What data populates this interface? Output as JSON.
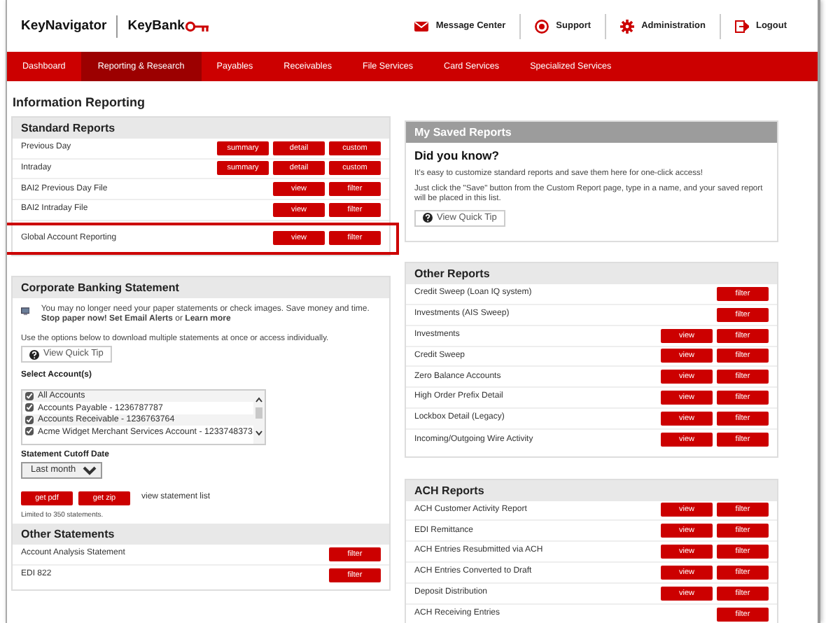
{
  "header": {
    "product": "KeyNavigator",
    "bank": "KeyBank",
    "links": [
      {
        "label": "Message Center"
      },
      {
        "label": "Support"
      },
      {
        "label": "Administration"
      },
      {
        "label": "Logout"
      }
    ]
  },
  "nav": [
    {
      "label": "Dashboard",
      "selected": false
    },
    {
      "label": "Reporting & Research",
      "selected": true
    },
    {
      "label": "Payables",
      "selected": false
    },
    {
      "label": "Receivables",
      "selected": false
    },
    {
      "label": "File Services",
      "selected": false
    },
    {
      "label": "Card Services",
      "selected": false
    },
    {
      "label": "Specialized Services",
      "selected": false
    }
  ],
  "page_title": "Information Reporting",
  "standard_reports": {
    "title": "Standard Reports",
    "rows": [
      {
        "label": "Previous Day",
        "buttons": [
          "summary",
          "detail",
          "custom"
        ],
        "highlighted": false
      },
      {
        "label": "Intraday",
        "buttons": [
          "summary",
          "detail",
          "custom"
        ],
        "highlighted": false
      },
      {
        "label": "BAI2 Previous Day File",
        "buttons": [
          "view",
          "filter"
        ],
        "highlighted": false
      },
      {
        "label": "BAI2 Intraday File",
        "buttons": [
          "view",
          "filter"
        ],
        "highlighted": false
      },
      {
        "label": "Global Account Reporting",
        "buttons": [
          "view",
          "filter"
        ],
        "highlighted": true
      }
    ]
  },
  "corporate_statement": {
    "title": "Corporate Banking Statement",
    "notice": "You may no longer need your paper statements or check images. Save money and time. **Stop paper now!**   **Set Email Alerts** or **Learn more**",
    "instructions": "Use the options below to download multiple statements at once or access individually.",
    "quick_tip": "View Quick Tip",
    "accounts_label": "Select Account(s)",
    "accounts": [
      {
        "label": "All Accounts",
        "checked": true
      },
      {
        "label": "Accounts Payable - 1236787787",
        "checked": true
      },
      {
        "label": "Accounts Receivable - 1236763764",
        "checked": true
      },
      {
        "label": "Acme Widget Merchant Services Account - 1233748373",
        "checked": true
      }
    ],
    "cutoff_label": "Statement Cutoff Date",
    "cutoff_value": "Last month",
    "buttons": [
      "get pdf",
      "get zip"
    ],
    "list_link": "view statement list",
    "limit_note": "Limited to 350 statements."
  },
  "other_statements": {
    "title": "Other Statements",
    "rows": [
      {
        "label": "Account Analysis Statement",
        "buttons": [
          "filter"
        ]
      },
      {
        "label": "EDI 822",
        "buttons": [
          "filter"
        ]
      }
    ]
  },
  "saved_reports": {
    "title": "My Saved Reports",
    "heading": "Did you know?",
    "paragraphs": [
      "It's easy to customize standard reports and save them here for one-click access!",
      "Just click the \"Save\" button from the Custom Report page, type in a name, and your saved report will be placed in this list."
    ],
    "quick_tip": "View Quick Tip"
  },
  "other_reports": {
    "title": "Other Reports",
    "rows": [
      {
        "label": "Credit Sweep (Loan IQ system)",
        "buttons": [
          "filter"
        ]
      },
      {
        "label": "Investments (AIS Sweep)",
        "buttons": [
          "filter"
        ]
      },
      {
        "label": "Investments",
        "buttons": [
          "view",
          "filter"
        ]
      },
      {
        "label": "Credit Sweep",
        "buttons": [
          "view",
          "filter"
        ]
      },
      {
        "label": "Zero Balance Accounts",
        "buttons": [
          "view",
          "filter"
        ]
      },
      {
        "label": "High Order Prefix Detail",
        "buttons": [
          "view",
          "filter"
        ]
      },
      {
        "label": "Lockbox Detail (Legacy)",
        "buttons": [
          "view",
          "filter"
        ]
      },
      {
        "label": "Incoming/Outgoing Wire Activity",
        "buttons": [
          "view",
          "filter"
        ]
      }
    ]
  },
  "ach_reports": {
    "title": "ACH Reports",
    "rows": [
      {
        "label": "ACH Customer Activity Report",
        "buttons": [
          "view",
          "filter"
        ]
      },
      {
        "label": "EDI Remittance",
        "buttons": [
          "view",
          "filter"
        ]
      },
      {
        "label": "ACH Entries Resubmitted via ACH",
        "buttons": [
          "view",
          "filter"
        ]
      },
      {
        "label": "ACH Entries Converted to Draft",
        "buttons": [
          "view",
          "filter"
        ]
      },
      {
        "label": "Deposit Distribution",
        "buttons": [
          "view",
          "filter"
        ]
      },
      {
        "label": "ACH Receiving Entries",
        "buttons": [
          "filter"
        ]
      }
    ]
  }
}
